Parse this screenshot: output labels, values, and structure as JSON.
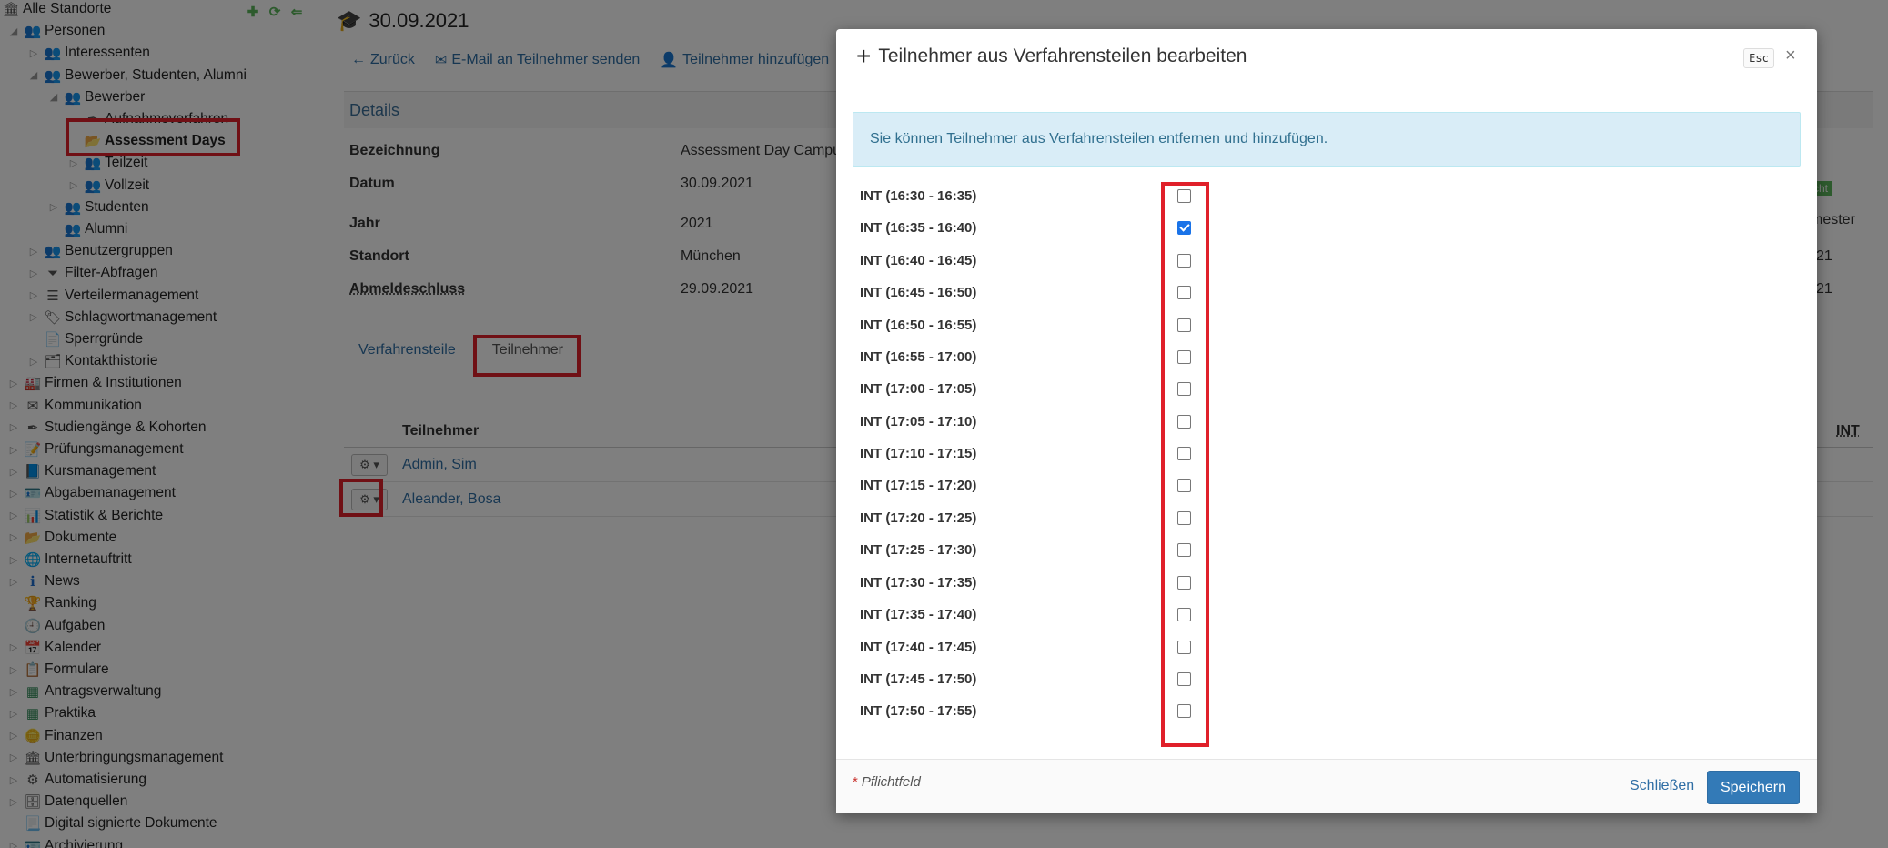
{
  "sidebar": {
    "items": [
      {
        "label": "Alle Standorte",
        "icon": "building-icon",
        "level": 0,
        "toggle": "none"
      },
      {
        "label": "Personen",
        "icon": "people-icon",
        "level": 1,
        "toggle": "open"
      },
      {
        "label": "Interessenten",
        "icon": "people-icon",
        "level": 2,
        "toggle": "closed"
      },
      {
        "label": "Bewerber, Studenten, Alumni",
        "icon": "people-icon",
        "level": 2,
        "toggle": "open"
      },
      {
        "label": "Bewerber",
        "icon": "people-icon",
        "level": 3,
        "toggle": "open"
      },
      {
        "label": "Aufnahmeverfahren",
        "icon": "feather-icon",
        "level": 4,
        "toggle": "none"
      },
      {
        "label": "Assessment Days",
        "icon": "folder-icon",
        "level": 4,
        "toggle": "none",
        "selected": true
      },
      {
        "label": "Teilzeit",
        "icon": "people-icon",
        "level": 4,
        "toggle": "closed"
      },
      {
        "label": "Vollzeit",
        "icon": "people-icon",
        "level": 4,
        "toggle": "closed"
      },
      {
        "label": "Studenten",
        "icon": "people-icon",
        "level": 3,
        "toggle": "closed"
      },
      {
        "label": "Alumni",
        "icon": "people-icon",
        "level": 3,
        "toggle": "none"
      },
      {
        "label": "Benutzergruppen",
        "icon": "people-icon",
        "level": 2,
        "toggle": "closed"
      },
      {
        "label": "Filter-Abfragen",
        "icon": "filter-icon",
        "level": 2,
        "toggle": "closed"
      },
      {
        "label": "Verteilermanagement",
        "icon": "list-icon",
        "level": 2,
        "toggle": "closed"
      },
      {
        "label": "Schlagwortmanagement",
        "icon": "tag-icon",
        "level": 2,
        "toggle": "closed"
      },
      {
        "label": "Sperrgründe",
        "icon": "document-icon",
        "level": 2,
        "toggle": "none"
      },
      {
        "label": "Kontakthistorie",
        "icon": "history-icon",
        "level": 2,
        "toggle": "closed"
      },
      {
        "label": "Firmen & Institutionen",
        "icon": "factory-icon",
        "level": 1,
        "toggle": "closed"
      },
      {
        "label": "Kommunikation",
        "icon": "envelope-icon",
        "level": 1,
        "toggle": "closed"
      },
      {
        "label": "Studiengänge & Kohorten",
        "icon": "feather-icon",
        "level": 1,
        "toggle": "closed"
      },
      {
        "label": "Prüfungsmanagement",
        "icon": "exam-icon",
        "level": 1,
        "toggle": "closed"
      },
      {
        "label": "Kursmanagement",
        "icon": "book-icon",
        "level": 1,
        "toggle": "closed"
      },
      {
        "label": "Abgabemanagement",
        "icon": "id-card-icon",
        "level": 1,
        "toggle": "closed"
      },
      {
        "label": "Statistik & Berichte",
        "icon": "bar-chart-icon",
        "level": 1,
        "toggle": "closed"
      },
      {
        "label": "Dokumente",
        "icon": "folder-icon",
        "level": 1,
        "toggle": "closed"
      },
      {
        "label": "Internetauftritt",
        "icon": "globe-icon",
        "level": 1,
        "toggle": "closed"
      },
      {
        "label": "News",
        "icon": "info-icon",
        "level": 1,
        "toggle": "closed"
      },
      {
        "label": "Ranking",
        "icon": "trophy-icon",
        "level": 1,
        "toggle": "none"
      },
      {
        "label": "Aufgaben",
        "icon": "clock-icon",
        "level": 1,
        "toggle": "none"
      },
      {
        "label": "Kalender",
        "icon": "calendar-icon",
        "level": 1,
        "toggle": "closed"
      },
      {
        "label": "Formulare",
        "icon": "form-icon",
        "level": 1,
        "toggle": "closed"
      },
      {
        "label": "Antragsverwaltung",
        "icon": "table-icon",
        "level": 1,
        "toggle": "closed"
      },
      {
        "label": "Praktika",
        "icon": "table-icon",
        "level": 1,
        "toggle": "closed"
      },
      {
        "label": "Finanzen",
        "icon": "coins-icon",
        "level": 1,
        "toggle": "closed"
      },
      {
        "label": "Unterbringungsmanagement",
        "icon": "building-icon",
        "level": 1,
        "toggle": "closed"
      },
      {
        "label": "Automatisierung",
        "icon": "gear-icon",
        "level": 1,
        "toggle": "closed"
      },
      {
        "label": "Datenquellen",
        "icon": "database-icon",
        "level": 1,
        "toggle": "closed"
      },
      {
        "label": "Digital signierte Dokumente",
        "icon": "signed-document-icon",
        "level": 1,
        "toggle": "none"
      },
      {
        "label": "Archivierung",
        "icon": "id-card-icon",
        "level": 1,
        "toggle": "closed"
      }
    ]
  },
  "main": {
    "title": "30.09.2021",
    "toolbar": {
      "back": "Zurück",
      "email": "E-Mail an Teilnehmer senden",
      "add": "Teilnehmer hinzufügen"
    },
    "details": {
      "heading": "Details",
      "rows": [
        {
          "key": "Bezeichnung",
          "value": "Assessment Day Campus"
        },
        {
          "key": "Datum",
          "value": "30.09.2021"
        },
        {
          "key": "Jahr",
          "value": "2021"
        },
        {
          "key": "Standort",
          "value": "München"
        },
        {
          "key": "Abmeldeschluss",
          "value": "29.09.2021"
        }
      ]
    },
    "tabs": [
      "Verfahrensteile",
      "Teilnehmer"
    ],
    "table": {
      "column": "Teilnehmer",
      "right_column": "INT",
      "rows": [
        "Admin, Sim",
        "Aleander, Bosa"
      ]
    },
    "partial_right": [
      "cht",
      "mester",
      "21",
      "21"
    ]
  },
  "modal": {
    "title": "Teilnehmer aus Verfahrensteilen bearbeiten",
    "esc": "Esc",
    "close": "×",
    "info": "Sie können Teilnehmer aus Verfahrensteilen entfernen und hinzufügen.",
    "slots": [
      {
        "label": "INT (16:30 - 16:35)",
        "checked": false
      },
      {
        "label": "INT (16:35 - 16:40)",
        "checked": true
      },
      {
        "label": "INT (16:40 - 16:45)",
        "checked": false
      },
      {
        "label": "INT (16:45 - 16:50)",
        "checked": false
      },
      {
        "label": "INT (16:50 - 16:55)",
        "checked": false
      },
      {
        "label": "INT (16:55 - 17:00)",
        "checked": false
      },
      {
        "label": "INT (17:00 - 17:05)",
        "checked": false
      },
      {
        "label": "INT (17:05 - 17:10)",
        "checked": false
      },
      {
        "label": "INT (17:10 - 17:15)",
        "checked": false
      },
      {
        "label": "INT (17:15 - 17:20)",
        "checked": false
      },
      {
        "label": "INT (17:20 - 17:25)",
        "checked": false
      },
      {
        "label": "INT (17:25 - 17:30)",
        "checked": false
      },
      {
        "label": "INT (17:30 - 17:35)",
        "checked": false
      },
      {
        "label": "INT (17:35 - 17:40)",
        "checked": false
      },
      {
        "label": "INT (17:40 - 17:45)",
        "checked": false
      },
      {
        "label": "INT (17:45 - 17:50)",
        "checked": false
      },
      {
        "label": "INT (17:50 - 17:55)",
        "checked": false
      }
    ],
    "footer": {
      "required_star": "*",
      "required_note": "Pflichtfeld",
      "close_label": "Schließen",
      "save_label": "Speichern"
    }
  },
  "colors": {
    "accent": "#337ab7",
    "link": "#2f6ea5",
    "highlight": "#e0202a",
    "info_bg": "#d9edf7"
  }
}
